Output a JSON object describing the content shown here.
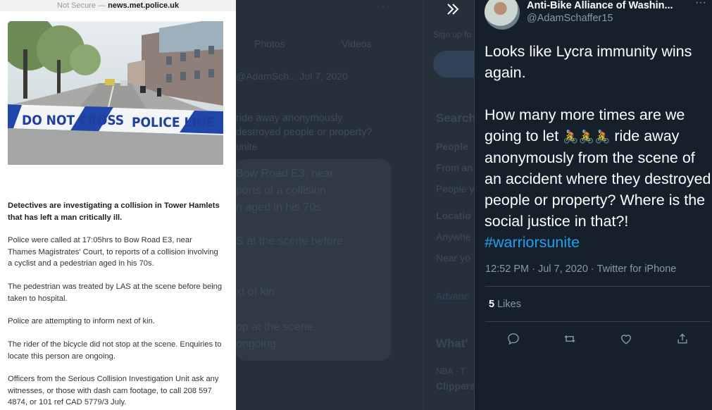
{
  "article": {
    "url_prefix": "Not Secure — ",
    "url_domain": "news.met.police.uk",
    "tape_left": "DO NOT CROSS",
    "tape_right": "POLICE LINE",
    "headline": "Detectives are investigating a collision in Tower Hamlets that has left a man critically ill.",
    "paragraphs": [
      "Police were called at 17:05hrs to Bow Road E3, near Thames Magistrates' Court, to reports of a collision involving a cyclist and a pedestrian aged in his 70s.",
      "The pedestrian was treated by LAS at the scene before being taken to hospital.",
      "Police are attempting to inform next of kin.",
      "The rider of the bicycle did not stop at the scene. Enquiries to locate this person are ongoing.",
      "Officers from the Serious Collision Investigation Unit ask any witnesses, or those with dash cam footage, to call 208 597 4874, or 101 ref CAD 5779/3 July."
    ]
  },
  "background": {
    "tab_photos": "Photos",
    "tab_videos": "Videos",
    "handle_date": "@AdamSch...   Jul 7, 2020",
    "tweet_line1": "ride away anonymously",
    "tweet_line2": "destroyed people or property?",
    "tweet_line3": "unite",
    "card_lines": [
      "Bow Road E3, near",
      "ports of a collision",
      "n aged in his 70s.",
      "S at the scene before",
      "xt of kin.",
      "op at the scene.",
      "ongoing."
    ],
    "signup": "Sign up fo",
    "search_heading": "Search",
    "people_heading": "People",
    "from_any": "From an",
    "people_you": "People y",
    "location_heading": "Locatio",
    "anywhere": "Anywhe",
    "near_you": "Near yo",
    "advanced": "Advanc",
    "whats": "What'",
    "nba": "NBA · T",
    "clippers": "Clippers"
  },
  "tweet": {
    "display_name": "Anti-Bike Alliance of Washin...",
    "handle": "@AdamSchaffer15",
    "more_icon": "more-dots-icon",
    "text_line1": "Looks like Lycra immunity wins again.",
    "text_line2_a": "How many more times are we going to let ",
    "emojis": "🚴🚴🚴",
    "text_line2_b": " ride away anonymously from the scene of an accident where they destroyed people or property? Where is the social justice in that?! ",
    "hashtag": "#warriorsunite",
    "meta": "12:52 PM · Jul 7, 2020 · Twitter for iPhone",
    "likes_count": "5",
    "likes_label": "Likes",
    "actions": [
      "reply-icon",
      "retweet-icon",
      "like-icon",
      "share-icon"
    ]
  },
  "colors": {
    "accent": "#1da1f2",
    "panel_bg": "#15202b",
    "muted_text": "#8899a6",
    "divider": "#38444d"
  }
}
